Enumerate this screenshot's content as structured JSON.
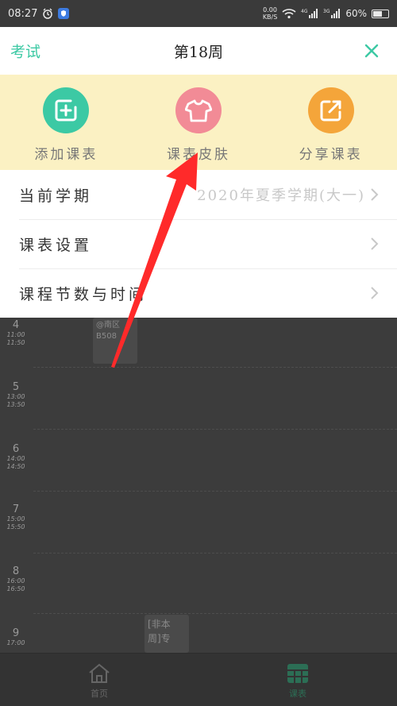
{
  "status_bar": {
    "time": "08:27",
    "net_speed_value": "0.00",
    "net_speed_unit": "KB/S",
    "signal1_label": "4G",
    "signal2_label": "3G",
    "battery": "60%",
    "battery_level": 0.6
  },
  "header": {
    "left_link": "考试",
    "title": "第18周"
  },
  "actions": [
    {
      "label": "添加课表",
      "icon": "add-calendar-icon",
      "color": "#3cc9a4"
    },
    {
      "label": "课表皮肤",
      "icon": "tshirt-icon",
      "color": "#f28b96"
    },
    {
      "label": "分享课表",
      "icon": "share-icon",
      "color": "#f4a53a"
    }
  ],
  "settings": [
    {
      "label": "当前学期",
      "value": "2020年夏季学期(大一)"
    },
    {
      "label": "课表设置",
      "value": ""
    },
    {
      "label": "课程节数与时间",
      "value": ""
    }
  ],
  "timetable": {
    "periods": [
      {
        "num": "4",
        "start": "11:00",
        "end": "11:50"
      },
      {
        "num": "5",
        "start": "13:00",
        "end": "13:50"
      },
      {
        "num": "6",
        "start": "14:00",
        "end": "14:50"
      },
      {
        "num": "7",
        "start": "15:00",
        "end": "15:50"
      },
      {
        "num": "8",
        "start": "16:00",
        "end": "16:50"
      },
      {
        "num": "9",
        "start": "17:00",
        "end": ""
      }
    ],
    "cards": [
      {
        "line1": "@南区",
        "line2": "B508"
      },
      {
        "line1": "[非本",
        "line2": "周]专"
      }
    ]
  },
  "bottom_nav": [
    {
      "label": "首页",
      "icon": "home-icon"
    },
    {
      "label": "课表",
      "icon": "timetable-icon"
    }
  ],
  "colors": {
    "accent": "#3cc9a4",
    "panel_bg": "#fbf1c3",
    "annotation": "#ff2a2a"
  }
}
